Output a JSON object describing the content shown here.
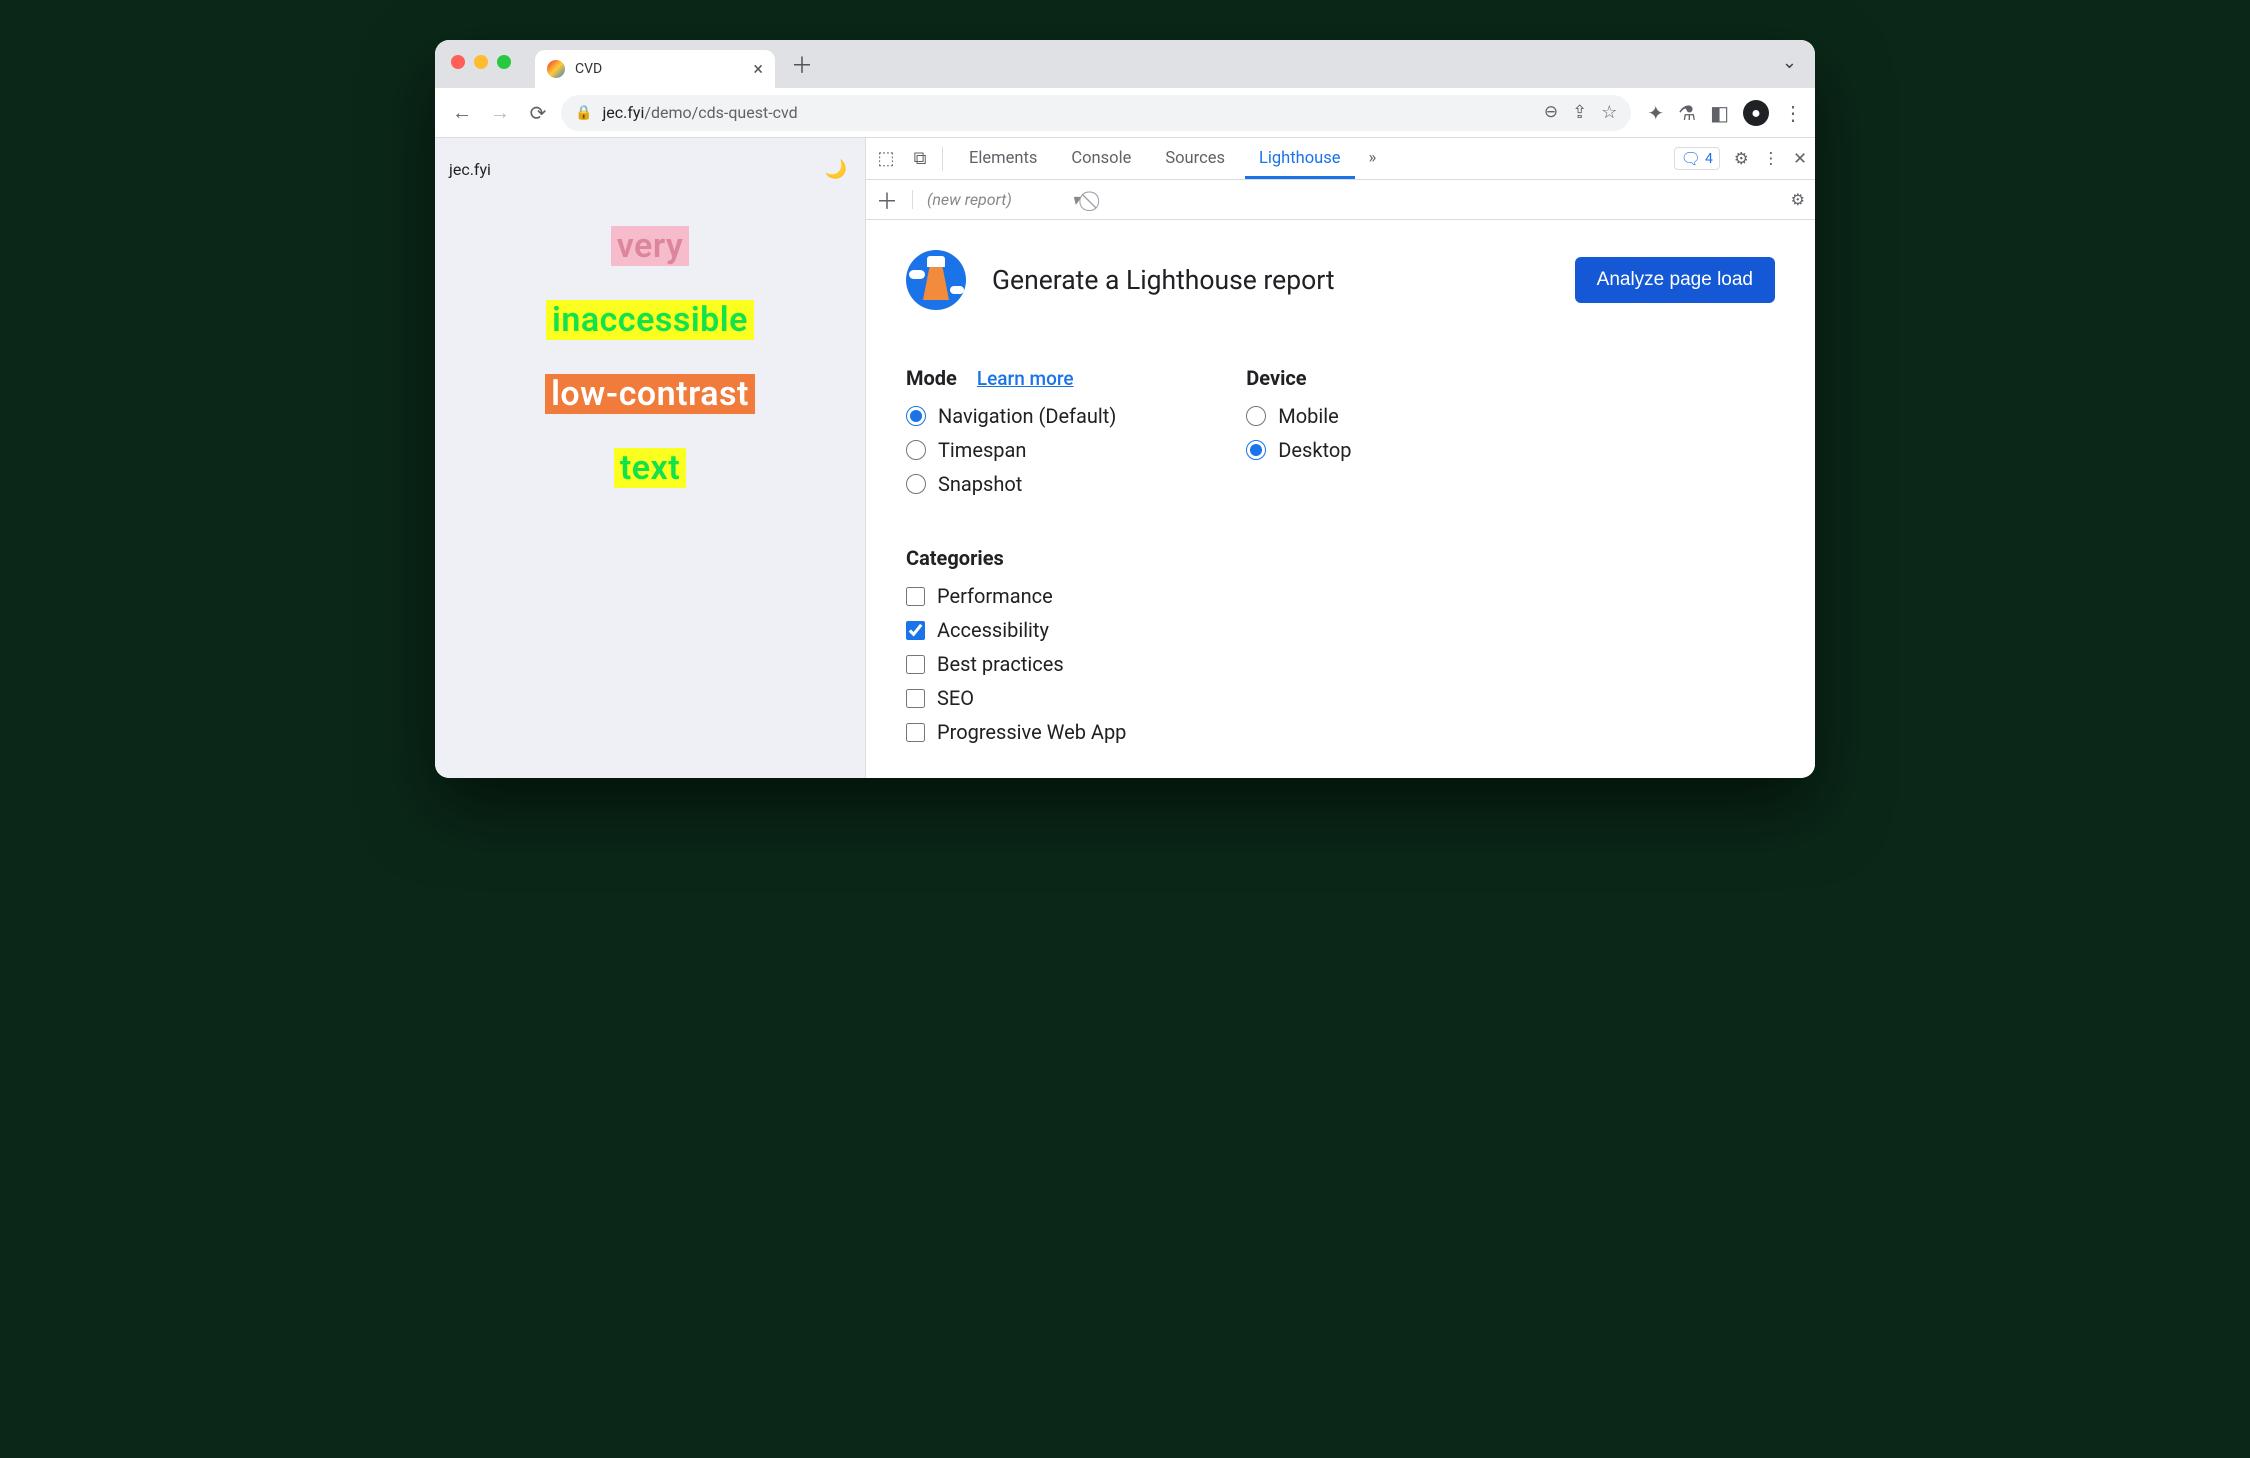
{
  "browser_tab": {
    "title": "CVD"
  },
  "url": {
    "host": "jec.fyi",
    "path": "/demo/cds-quest-cvd"
  },
  "page": {
    "brand": "jec.fyi",
    "words": [
      "very",
      "inaccessible",
      "low-contrast",
      "text"
    ]
  },
  "devtools": {
    "tabs": [
      "Elements",
      "Console",
      "Sources",
      "Lighthouse"
    ],
    "active_tab": "Lighthouse",
    "issues_count": "4",
    "subbar": {
      "new_report_label": "(new report)"
    }
  },
  "lighthouse": {
    "title": "Generate a Lighthouse report",
    "analyze_label": "Analyze page load",
    "mode_label": "Mode",
    "learn_more": "Learn more",
    "modes": [
      {
        "label": "Navigation (Default)",
        "checked": true
      },
      {
        "label": "Timespan",
        "checked": false
      },
      {
        "label": "Snapshot",
        "checked": false
      }
    ],
    "device_label": "Device",
    "devices": [
      {
        "label": "Mobile",
        "checked": false
      },
      {
        "label": "Desktop",
        "checked": true
      }
    ],
    "categories_label": "Categories",
    "categories": [
      {
        "label": "Performance",
        "checked": false
      },
      {
        "label": "Accessibility",
        "checked": true
      },
      {
        "label": "Best practices",
        "checked": false
      },
      {
        "label": "SEO",
        "checked": false
      },
      {
        "label": "Progressive Web App",
        "checked": false
      }
    ]
  }
}
